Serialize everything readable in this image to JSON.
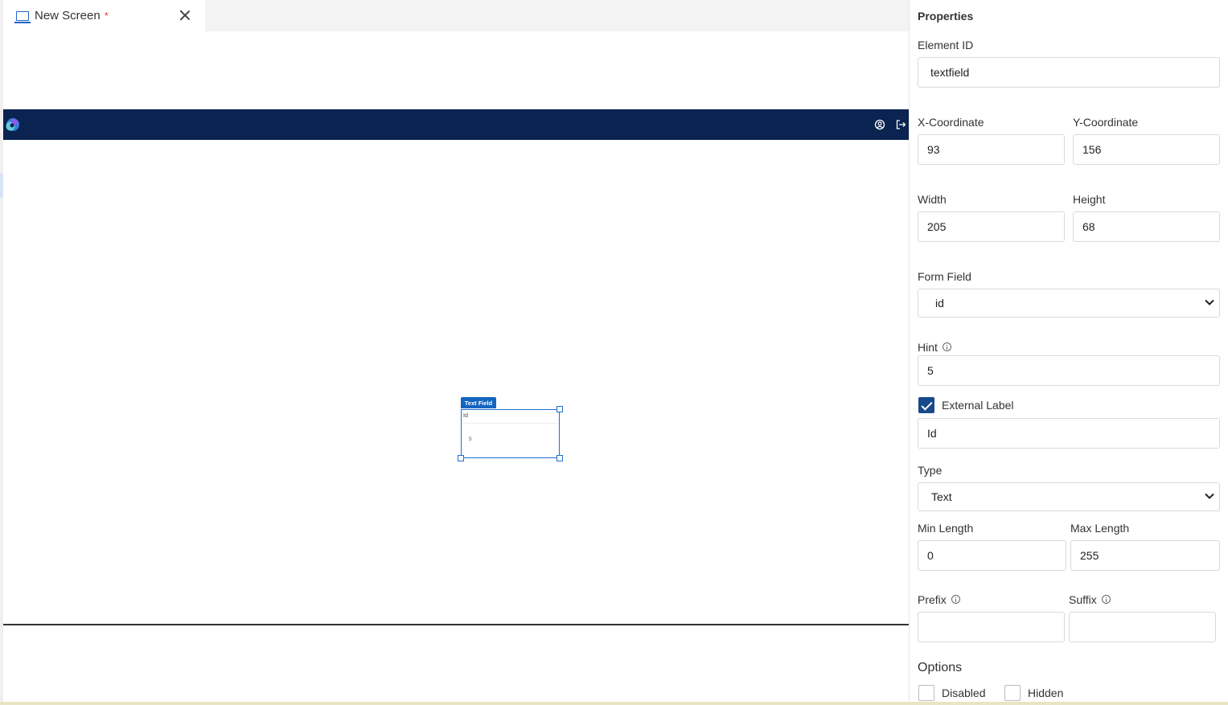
{
  "tab": {
    "title": "New Screen",
    "modified_marker": "*"
  },
  "canvas": {
    "element_tag": "Text Field",
    "element_label": "Id",
    "element_hint": "5"
  },
  "properties": {
    "title": "Properties",
    "element_id": {
      "label": "Element ID",
      "value": "textfield"
    },
    "x": {
      "label": "X-Coordinate",
      "value": "93"
    },
    "y": {
      "label": "Y-Coordinate",
      "value": "156"
    },
    "width": {
      "label": "Width",
      "value": "205"
    },
    "height": {
      "label": "Height",
      "value": "68"
    },
    "form_field": {
      "label": "Form Field",
      "value": "id"
    },
    "hint": {
      "label": "Hint",
      "value": "5"
    },
    "external_label": {
      "label": "External Label",
      "checked": true,
      "value": "Id"
    },
    "type": {
      "label": "Type",
      "value": "Text"
    },
    "min_length": {
      "label": "Min Length",
      "value": "0"
    },
    "max_length": {
      "label": "Max Length",
      "value": "255"
    },
    "prefix": {
      "label": "Prefix",
      "value": ""
    },
    "suffix": {
      "label": "Suffix",
      "value": ""
    },
    "options": {
      "title": "Options",
      "disabled": {
        "label": "Disabled",
        "checked": false
      },
      "hidden": {
        "label": "Hidden",
        "checked": false
      }
    }
  },
  "colors": {
    "header_bg": "#0a2350",
    "accent": "#1565c0",
    "checkbox_checked": "#174a8b"
  },
  "icons": {
    "tab": "monitor-icon",
    "close": "close-icon",
    "logo": "app-logo",
    "user": "user-circle-icon",
    "logout": "logout-icon",
    "info": "info-icon",
    "select": "chevron-down-icon"
  }
}
